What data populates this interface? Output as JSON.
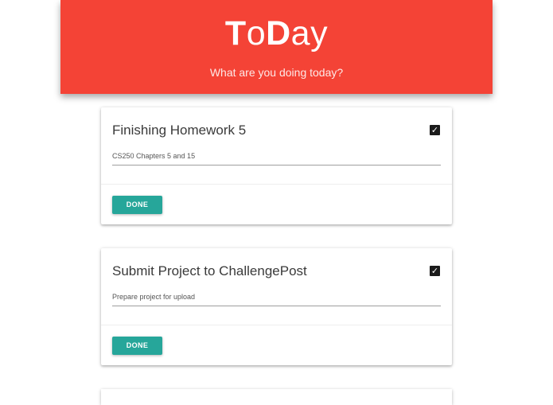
{
  "header": {
    "title_parts": [
      {
        "text": "T",
        "bold": true
      },
      {
        "text": "o",
        "bold": false
      },
      {
        "text": "D",
        "bold": true
      },
      {
        "text": "ay",
        "bold": false
      }
    ],
    "subtitle": "What are you doing today?"
  },
  "tasks": [
    {
      "title": "Finishing Homework 5",
      "description": "CS250 Chapters 5 and 15",
      "checked": true,
      "button_label": "DONE"
    },
    {
      "title": "Submit Project to ChallengePost",
      "description": "Prepare project for upload",
      "checked": true,
      "button_label": "DONE"
    }
  ],
  "colors": {
    "header": "#f44336",
    "button": "#26a69a"
  }
}
